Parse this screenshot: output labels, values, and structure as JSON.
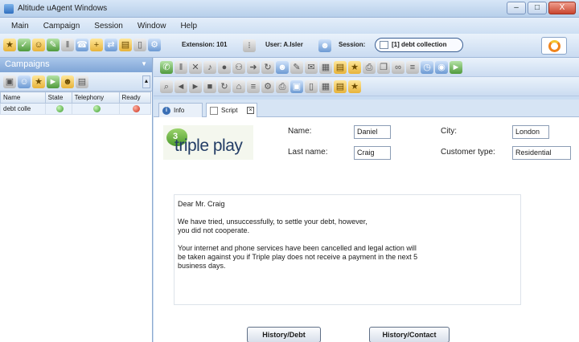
{
  "window": {
    "title": "Altitude uAgent Windows",
    "controls": [
      "–",
      "□",
      "X"
    ]
  },
  "menu": [
    "Main",
    "Campaign",
    "Session",
    "Window",
    "Help"
  ],
  "toolbar": {
    "extension_label": "Extension: 101",
    "user_label": "User: A.Isler",
    "session_label": "Session:",
    "session_value": "[1] debt collection"
  },
  "campaigns_panel": {
    "title": "Campaigns",
    "columns": [
      "Name",
      "State",
      "Telephony",
      "Ready"
    ],
    "rows": [
      {
        "name": "debt colle",
        "state": "green",
        "telephony": "green",
        "ready": "red"
      }
    ]
  },
  "tabs": [
    {
      "label": "Info",
      "active": false
    },
    {
      "label": "Script",
      "active": true
    }
  ],
  "form": {
    "logo_text": "triple play",
    "logo_mark": "3",
    "name_label": "Name:",
    "name_value": "Daniel",
    "last_name_label": "Last name:",
    "last_name_value": "Craig",
    "city_label": "City:",
    "city_value": "London",
    "customer_type_label": "Customer type:",
    "customer_type_value": "Residential"
  },
  "letter": {
    "salutation": "Dear Mr. Craig",
    "line1": "We have tried, unsuccessfully, to settle your debt, however,",
    "line2": "you did not cooperate.",
    "line3": "Your internet and phone services have been cancelled and legal action will",
    "line4": "be taken against you if Triple play does not receive a payment in the next 5",
    "line5": "business days."
  },
  "buttons": {
    "history_debt": "History/Debt",
    "history_contact": "History/Contact"
  }
}
